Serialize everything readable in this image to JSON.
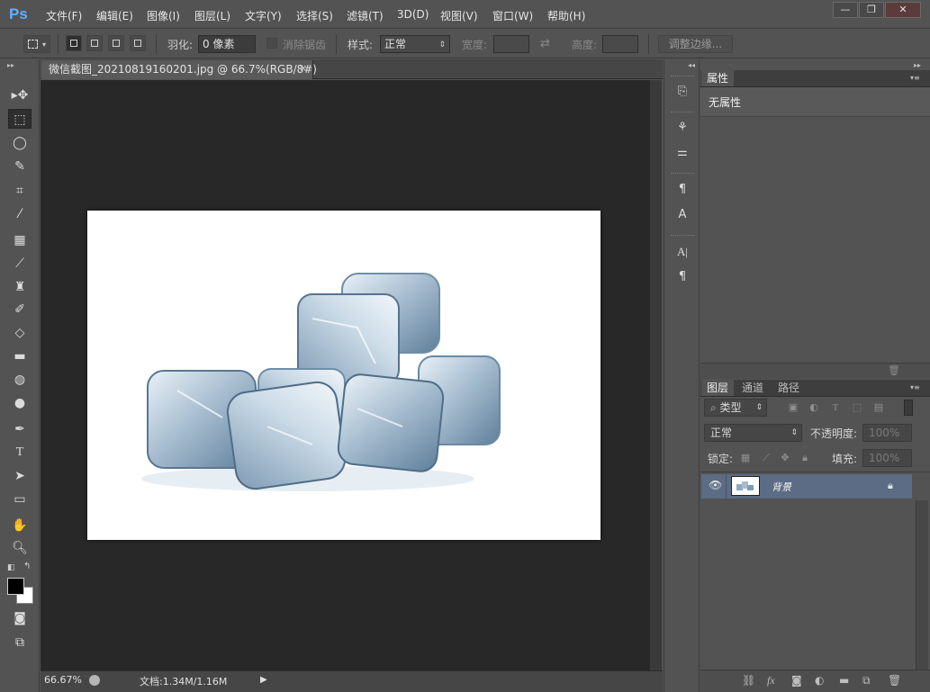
{
  "app": {
    "logo": "Ps",
    "menu": [
      "文件(F)",
      "编辑(E)",
      "图像(I)",
      "图层(L)",
      "文字(Y)",
      "选择(S)",
      "滤镜(T)",
      "3D(D)",
      "视图(V)",
      "窗口(W)",
      "帮助(H)"
    ],
    "window_controls": {
      "minimize": "—",
      "restore": "❐",
      "close": "✕"
    }
  },
  "options": {
    "feather_label": "羽化:",
    "feather_value": "0 像素",
    "antialias_label": "消除锯齿",
    "style_label": "样式:",
    "style_value": "正常",
    "width_label": "宽度:",
    "height_label": "高度:",
    "refine_button": "调整边缘..."
  },
  "document": {
    "tab_title": "微信截图_20210819160201.jpg @ 66.7%(RGB/8#)",
    "tab_close": "×",
    "zoom": "66.67%",
    "doc_info": "文档:1.34M/1.16M"
  },
  "properties": {
    "tab": "属性",
    "content": "无属性"
  },
  "layers": {
    "tabs": [
      "图层",
      "通道",
      "路径"
    ],
    "filter_kind": "类型",
    "blend_mode": "正常",
    "opacity_label": "不透明度:",
    "opacity_value": "100%",
    "lock_label": "锁定:",
    "fill_label": "填充:",
    "fill_value": "100%",
    "layer_name": "背景"
  },
  "colors": {
    "accent": "#5eb0ff",
    "selected_layer": "#5b6c84",
    "canvas_bg": "#282828",
    "panel_bg": "#535353"
  }
}
